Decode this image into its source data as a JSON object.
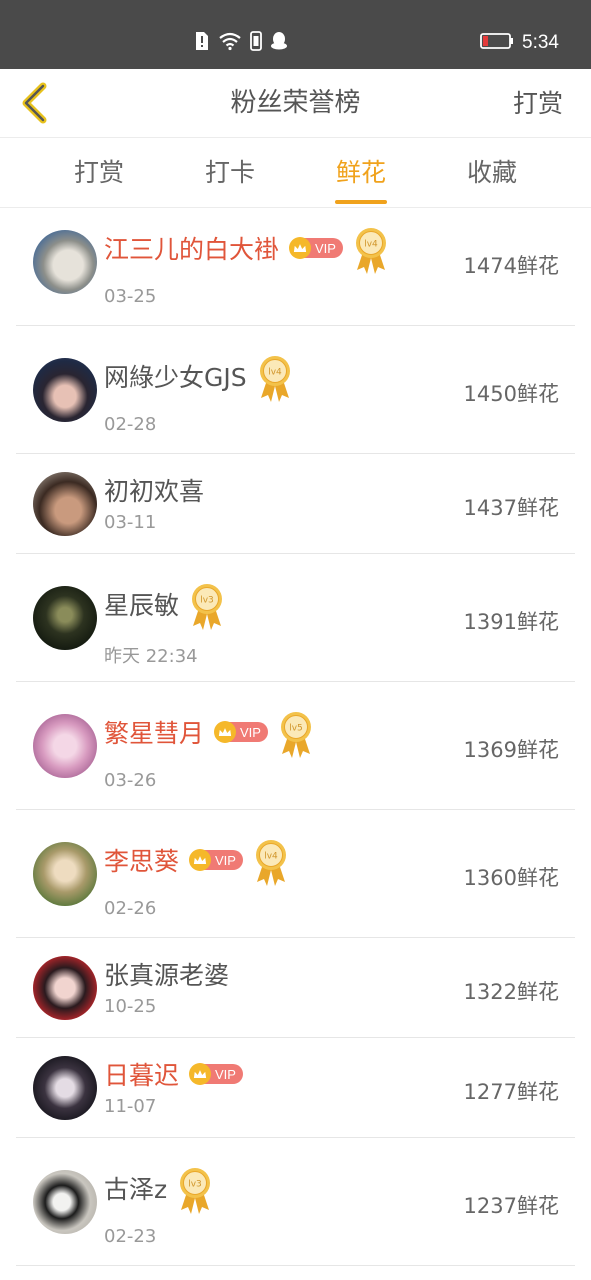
{
  "status_bar": {
    "time": "5:34",
    "icons": [
      "alert-icon",
      "wifi-icon",
      "phone-icon",
      "qq-icon",
      "battery-icon"
    ]
  },
  "nav": {
    "title": "粉丝荣誉榜",
    "action": "打赏"
  },
  "tabs": [
    {
      "label": "打赏",
      "active": false
    },
    {
      "label": "打卡",
      "active": false
    },
    {
      "label": "鲜花",
      "active": true
    },
    {
      "label": "收藏",
      "active": false
    }
  ],
  "colors": {
    "accent": "#f0a21c",
    "vip_name": "#e0553a",
    "status_bar": "#4a4a4a"
  },
  "fans": [
    {
      "name": "江三儿的白大褂",
      "vip": true,
      "vip_label": "VIP",
      "level": "lv4",
      "date": "03-25",
      "count": "1474鲜花"
    },
    {
      "name": "网綠少女GJS",
      "vip": false,
      "level": "lv4",
      "date": "02-28",
      "count": "1450鲜花"
    },
    {
      "name": "初初欢喜",
      "vip": false,
      "level": "",
      "date": "03-11",
      "count": "1437鲜花"
    },
    {
      "name": "星辰敏",
      "vip": false,
      "level": "lv3",
      "date": "昨天 22:34",
      "count": "1391鲜花"
    },
    {
      "name": "繁星彗月",
      "vip": true,
      "vip_label": "VIP",
      "level": "lv5",
      "date": "03-26",
      "count": "1369鲜花"
    },
    {
      "name": "李思葵",
      "vip": true,
      "vip_label": "VIP",
      "level": "lv4",
      "date": "02-26",
      "count": "1360鲜花"
    },
    {
      "name": "张真源老婆",
      "vip": false,
      "level": "",
      "date": "10-25",
      "count": "1322鲜花"
    },
    {
      "name": "日暮迟",
      "vip": true,
      "vip_label": "VIP",
      "level": "",
      "date": "11-07",
      "count": "1277鲜花"
    },
    {
      "name": "古泽z",
      "vip": false,
      "level": "lv3",
      "date": "02-23",
      "count": "1237鲜花"
    }
  ]
}
